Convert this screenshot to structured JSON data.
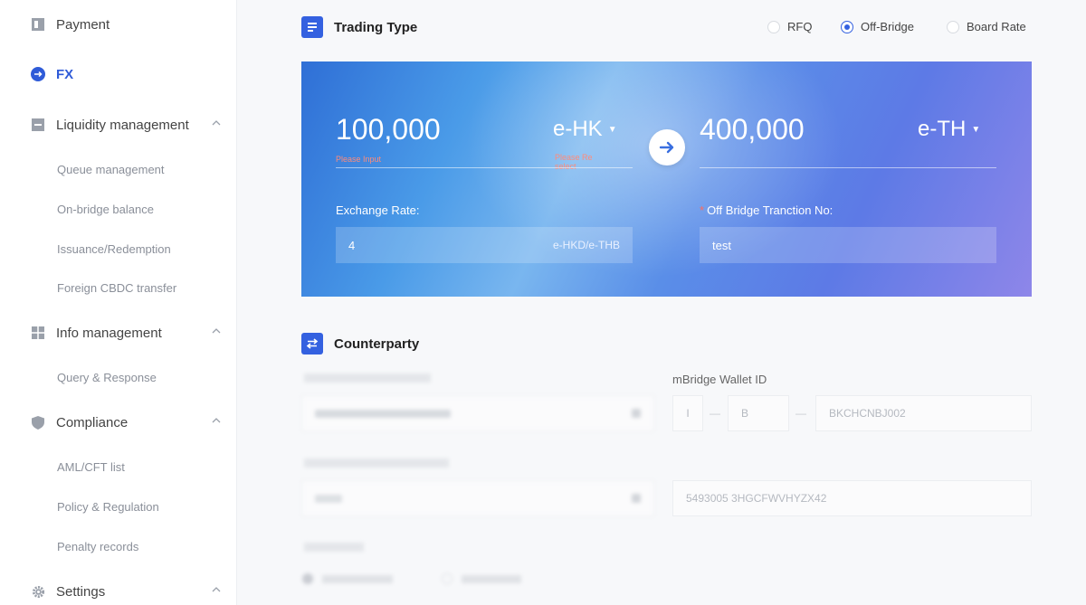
{
  "sidebar": {
    "items": [
      {
        "label": "Payment",
        "icon": "payment-icon"
      },
      {
        "label": "FX",
        "icon": "fx-icon"
      },
      {
        "label": "Liquidity management",
        "icon": "liquidity-icon"
      },
      {
        "label": "Info management",
        "icon": "info-icon"
      },
      {
        "label": "Compliance",
        "icon": "shield-icon"
      },
      {
        "label": "Settings",
        "icon": "gear-icon"
      }
    ],
    "sub": {
      "liquidity": [
        "Queue management",
        "On-bridge balance",
        "Issuance/Redemption",
        "Foreign CBDC transfer"
      ],
      "info": [
        "Query & Response"
      ],
      "compliance": [
        "AML/CFT list",
        "Policy & Regulation",
        "Penalty records"
      ]
    }
  },
  "trading": {
    "title": "Trading Type",
    "options": [
      "RFQ",
      "Off-Bridge",
      "Board Rate"
    ],
    "selected": "Off-Bridge"
  },
  "fx": {
    "from_amount": "100,000",
    "from_currency": "e-HK",
    "from_hint": "Please Input",
    "from_ccy_hint_1": "Please Re",
    "from_ccy_hint_2": "select",
    "to_amount": "400,000",
    "to_currency": "e-TH",
    "exchange_rate_label": "Exchange Rate:",
    "exchange_rate_value": "4",
    "exchange_rate_unit": "e-HKD/e-THB",
    "txn_label": "Off Bridge Tranction No:",
    "txn_value": "test"
  },
  "counterparty": {
    "title": "Counterparty",
    "wallet_label": "mBridge Wallet ID",
    "wallet_part1": "I",
    "wallet_part2": "B",
    "wallet_code": "BKCHCNBJ002",
    "second_code": "5493005 3HGCFWVHYZX42"
  },
  "colors": {
    "accent": "#3461e0",
    "warning": "#ff8b7a"
  }
}
